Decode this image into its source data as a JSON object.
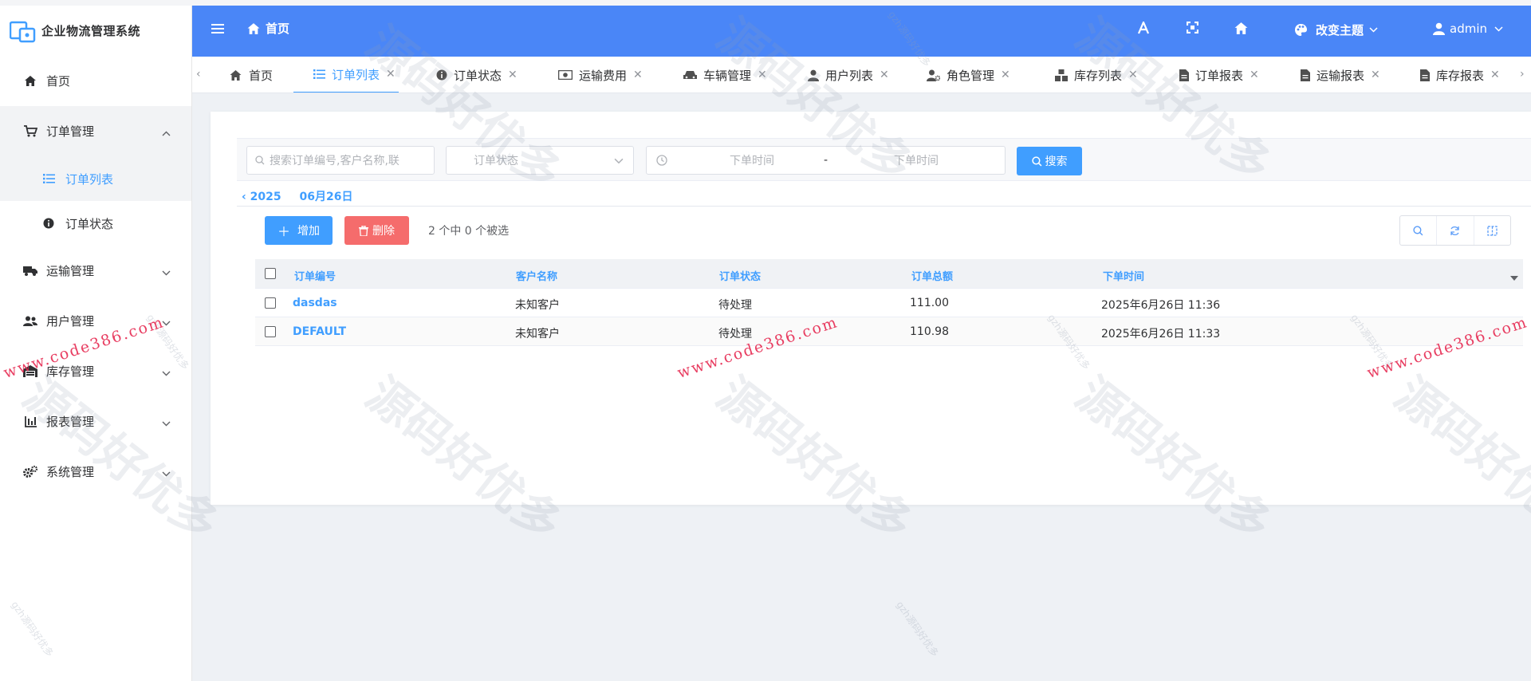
{
  "app": {
    "title": "企业物流管理系统"
  },
  "sidebar": {
    "items": [
      {
        "label": "首页",
        "icon": "home-icon"
      },
      {
        "label": "订单管理",
        "icon": "cart-icon",
        "expanded": true,
        "children": [
          {
            "label": "订单列表",
            "icon": "list-icon",
            "active": true
          },
          {
            "label": "订单状态",
            "icon": "info-icon"
          }
        ]
      },
      {
        "label": "运输管理",
        "icon": "truck-icon"
      },
      {
        "label": "用户管理",
        "icon": "users-icon"
      },
      {
        "label": "库存管理",
        "icon": "warehouse-icon"
      },
      {
        "label": "报表管理",
        "icon": "chart-icon"
      },
      {
        "label": "系统管理",
        "icon": "cogs-icon"
      }
    ]
  },
  "navbar": {
    "breadcrumb": "首页",
    "theme_label": "改变主题",
    "user_label": "admin"
  },
  "tabs": [
    {
      "label": "首页",
      "icon": "home-icon",
      "closable": false
    },
    {
      "label": "订单列表",
      "icon": "list-icon",
      "closable": true,
      "active": true
    },
    {
      "label": "订单状态",
      "icon": "info-icon",
      "closable": true
    },
    {
      "label": "运输费用",
      "icon": "money-icon",
      "closable": true
    },
    {
      "label": "车辆管理",
      "icon": "car-icon",
      "closable": true
    },
    {
      "label": "用户列表",
      "icon": "user-icon",
      "closable": true
    },
    {
      "label": "角色管理",
      "icon": "user-cog-icon",
      "closable": true
    },
    {
      "label": "库存列表",
      "icon": "cubes-icon",
      "closable": true
    },
    {
      "label": "订单报表",
      "icon": "file-icon",
      "closable": true
    },
    {
      "label": "运输报表",
      "icon": "file-icon",
      "closable": true
    },
    {
      "label": "库存报表",
      "icon": "file-icon",
      "closable": true
    }
  ],
  "search": {
    "keyword_placeholder": "搜索订单编号,客户名称,联",
    "status_placeholder": "订单状态",
    "date_start_placeholder": "下单时间",
    "date_sep": "-",
    "date_end_placeholder": "下单时间",
    "search_button": "搜索"
  },
  "date_nav": {
    "year": "‹ 2025",
    "day": "06月26日"
  },
  "toolbar": {
    "add_label": "增加",
    "delete_label": "删除",
    "selection_info": "2 个中 0 个被选"
  },
  "table": {
    "columns": [
      "订单编号",
      "客户名称",
      "订单状态",
      "订单总额",
      "下单时间"
    ],
    "rows": [
      {
        "order_no": "dasdas",
        "customer": "未知客户",
        "status": "待处理",
        "total": "111.00",
        "time": "2025年6月26日 11:36"
      },
      {
        "order_no": "DEFAULT",
        "customer": "未知客户",
        "status": "待处理",
        "total": "110.98",
        "time": "2025年6月26日 11:33"
      }
    ]
  },
  "watermarks": {
    "big": "源码好优多",
    "small": "gzh源码好优多",
    "url": "www.code386.com"
  },
  "colors": {
    "primary": "#409eff",
    "navbar": "#4a86f7",
    "danger": "#f56c6c"
  }
}
